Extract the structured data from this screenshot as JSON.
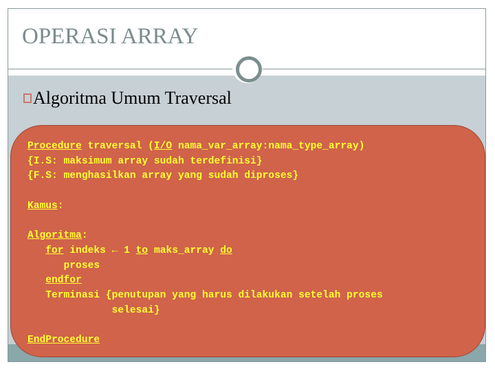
{
  "slide": {
    "title": "OPERASI ARRAY",
    "heading": "Algoritma Umum Traversal",
    "bullet_icon": "square-bullet-icon"
  },
  "code": {
    "line1": {
      "kw1": "Procedure",
      "t1": " traversal (",
      "kw2": "I/O",
      "t2": " nama_var_array:nama_type_array)"
    },
    "line2": "{I.S: maksimum array sudah terdefinisi}",
    "line3": "{F.S: menghasilkan array yang sudah diproses}",
    "line4": "",
    "line5": {
      "kw": "Kamus",
      "t": ":"
    },
    "line6": "",
    "line7": {
      "kw": "Algoritma",
      "t": ":"
    },
    "line8": {
      "indent": "   ",
      "kw1": "for",
      "t1": " indeks ",
      "arrow": "←",
      "t2": " 1 ",
      "kw2": "to",
      "t3": " maks_array ",
      "kw3": "do"
    },
    "line9": "      proses",
    "line10": {
      "indent": "   ",
      "kw": "endfor"
    },
    "line11": "   Terminasi {penutupan yang harus dilakukan setelah proses",
    "line12": "              selesai}",
    "line13": "",
    "line14": {
      "kw": "EndProcedure"
    }
  },
  "colors": {
    "title": "#7b8b8c",
    "band": "#c7d0d5",
    "footer": "#8aa7aa",
    "code_bg": "#d0634a",
    "code_text": "#ffff33"
  }
}
